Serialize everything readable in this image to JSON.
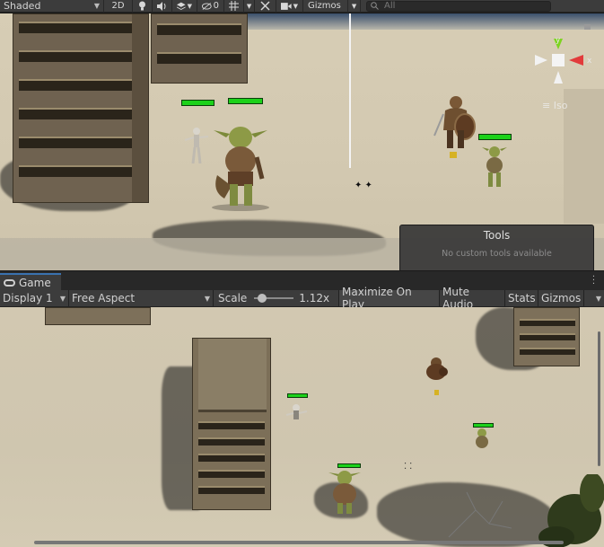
{
  "scene_toolbar": {
    "shading_mode": "Shaded",
    "mode_2d": "2D",
    "light_icon": "lightbulb-icon",
    "audio_icon": "speaker-icon",
    "effects_icon": "layers-icon",
    "hidden_count": "0",
    "gizmos_label": "Gizmos",
    "search_placeholder": "All"
  },
  "scene_view": {
    "gizmo": {
      "y_label": "y",
      "x_label": "x"
    },
    "projection_label": "Iso",
    "tools_overlay": {
      "title": "Tools",
      "message": "No custom tools available"
    }
  },
  "game_panel": {
    "tab_label": "Game",
    "display_label": "Display 1",
    "aspect_label": "Free Aspect",
    "scale_label": "Scale",
    "scale_value": "1.12x",
    "scale_fraction": 0.12,
    "maximize_label": "Maximize On Play",
    "mute_label": "Mute Audio",
    "stats_label": "Stats",
    "gizmos_label": "Gizmos"
  },
  "colors": {
    "health_green": "#1cd11a",
    "sand": "#d3c9b1",
    "panel_dark": "#3c3c3c",
    "tab_accent": "#3a72b0",
    "gizmo_y": "#7ed321",
    "gizmo_x": "#e23b3b"
  }
}
